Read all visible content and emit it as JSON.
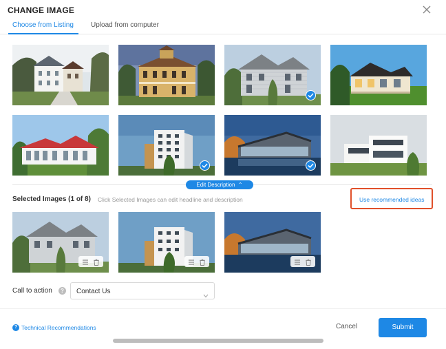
{
  "header": {
    "title": "CHANGE IMAGE"
  },
  "tabs": [
    {
      "label": "Choose from Listing",
      "active": true
    },
    {
      "label": "Upload from computer",
      "active": false
    }
  ],
  "listing_images": [
    {
      "id": "img1",
      "subject": "white-villa-driveway",
      "selected": false
    },
    {
      "id": "img2",
      "subject": "ornate-mansion",
      "selected": false
    },
    {
      "id": "img3",
      "subject": "gray-wood-house",
      "selected": true
    },
    {
      "id": "img4",
      "subject": "modern-dark-roof-house",
      "selected": false
    },
    {
      "id": "img5",
      "subject": "white-red-roof-house",
      "selected": false
    },
    {
      "id": "img6",
      "subject": "apartment-tower",
      "selected": true
    },
    {
      "id": "img7",
      "subject": "lakeside-modern-pavilion",
      "selected": true
    },
    {
      "id": "img8",
      "subject": "white-cube-villas",
      "selected": false
    }
  ],
  "edit_description": {
    "label": "Edit Description",
    "icon": "chevron-up-icon"
  },
  "selected": {
    "label": "Selected Images (1 of 8)",
    "hint": "Click Selected Images can edit headline and description",
    "recommend_link": "Use recommended ideas",
    "items": [
      {
        "id": "img3",
        "subject": "gray-wood-house"
      },
      {
        "id": "img6",
        "subject": "apartment-tower"
      },
      {
        "id": "img7",
        "subject": "lakeside-modern-pavilion"
      }
    ]
  },
  "call_to_action": {
    "label": "Call to action",
    "value": "Contact Us",
    "options": [
      "Contact Us"
    ]
  },
  "footer": {
    "tech_link": "Technical Recommendations",
    "cancel_label": "Cancel",
    "submit_label": "Submit"
  },
  "colors": {
    "accent": "#1e88e5",
    "highlight_border": "#e0502a",
    "text": "#333333",
    "muted": "#999999"
  }
}
